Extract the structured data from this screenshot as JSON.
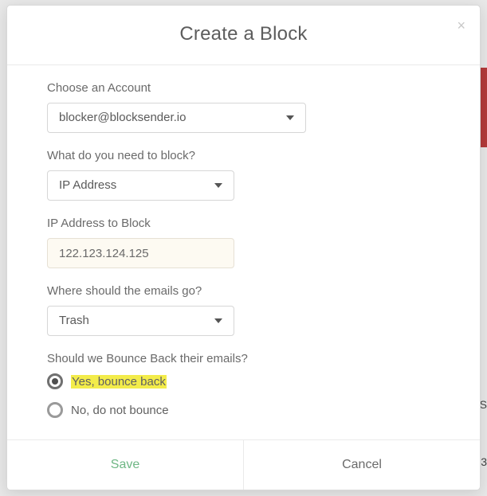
{
  "modal": {
    "title": "Create a Block",
    "closeGlyph": "×"
  },
  "account": {
    "label": "Choose an Account",
    "selected": "blocker@blocksender.io"
  },
  "blockType": {
    "label": "What do you need to block?",
    "selected": "IP Address"
  },
  "ipField": {
    "label": "IP Address to Block",
    "value": "122.123.124.125"
  },
  "destination": {
    "label": "Where should the emails go?",
    "selected": "Trash"
  },
  "bounce": {
    "label": "Should we Bounce Back their emails?",
    "optYes": "Yes, bounce back",
    "optNo": "No, do not bounce"
  },
  "footer": {
    "save": "Save",
    "cancel": "Cancel"
  },
  "bg": {
    "s": "S",
    "three": "3"
  }
}
